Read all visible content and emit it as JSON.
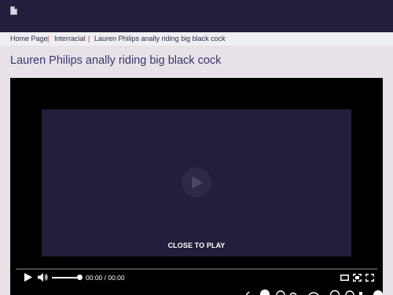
{
  "header": {
    "logo_icon": "broken-image-icon"
  },
  "breadcrumb": {
    "items": [
      "Home Page",
      "Interracial",
      "Lauren Philips anally riding big black cock"
    ],
    "separator": "|"
  },
  "page_title": "Lauren Philips anally riding big black cock",
  "player": {
    "overlay_label": "CLOSE TO PLAY",
    "time_display": "00:00 / 00:00",
    "play_icon": "play-icon",
    "volume_icon": "volume-icon",
    "theater_icon": "theater-mode-icon",
    "pip_icon": "picture-in-picture-icon",
    "fullscreen_icon": "fullscreen-icon",
    "volume_level": 1.0
  },
  "colors": {
    "header_bg": "#221e3b",
    "page_bg": "#e8e2e8",
    "title": "#3a3570",
    "separator": "#c0392b"
  }
}
